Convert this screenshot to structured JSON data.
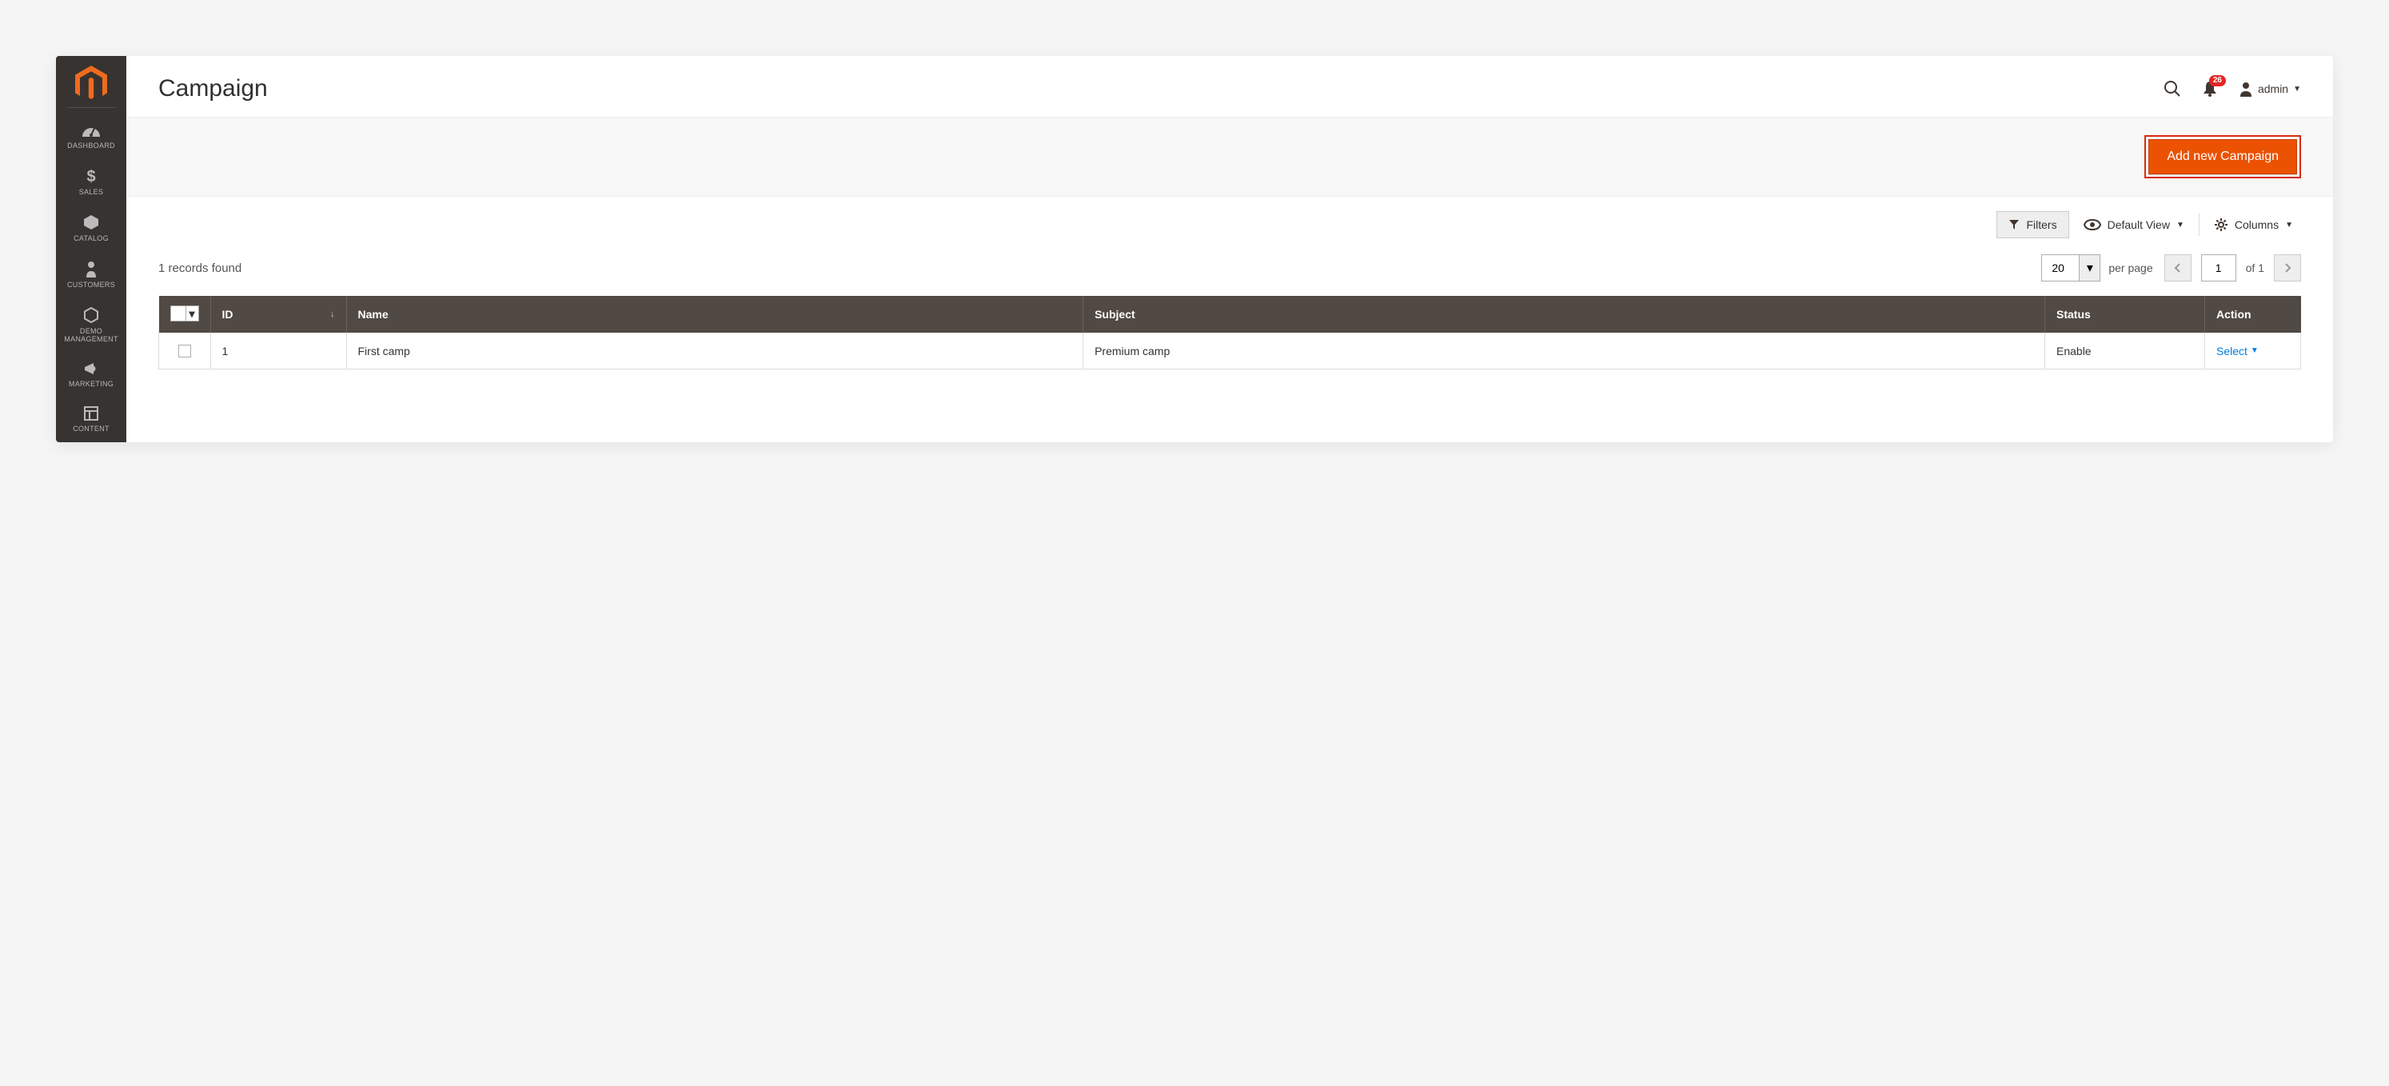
{
  "sidebar": {
    "items": [
      {
        "label": "DASHBOARD"
      },
      {
        "label": "SALES"
      },
      {
        "label": "CATALOG"
      },
      {
        "label": "CUSTOMERS"
      },
      {
        "label": "DEMO MANAGEMENT"
      },
      {
        "label": "MARKETING"
      },
      {
        "label": "CONTENT"
      }
    ]
  },
  "header": {
    "title": "Campaign",
    "notification_count": "26",
    "user_label": "admin"
  },
  "actions": {
    "add_new_campaign": "Add new Campaign"
  },
  "toolbar": {
    "filters_label": "Filters",
    "default_view_label": "Default View",
    "columns_label": "Columns"
  },
  "pager": {
    "records_found": "1 records found",
    "per_page_value": "20",
    "per_page_label": "per page",
    "current_page": "1",
    "of_label": "of",
    "total_pages": "1"
  },
  "grid": {
    "columns": {
      "id": "ID",
      "name": "Name",
      "subject": "Subject",
      "status": "Status",
      "action": "Action"
    },
    "rows": [
      {
        "id": "1",
        "name": "First camp",
        "subject": "Premium camp",
        "status": "Enable",
        "action": "Select"
      }
    ]
  }
}
